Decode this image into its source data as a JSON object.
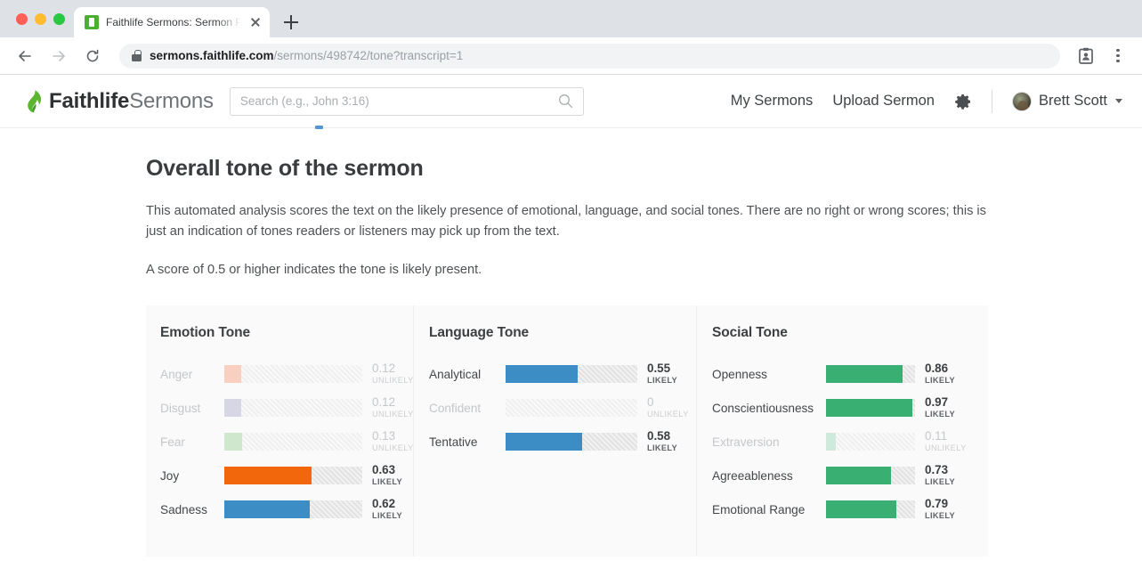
{
  "browser": {
    "tab_title": "Faithlife Sermons: Sermon Prepa",
    "favicon_name": "faithlife-favicon",
    "new_tab_label": "+",
    "url_domain": "sermons.faithlife.com",
    "url_path": "/sermons/498742/tone?transcript=1",
    "back_icon": "back-arrow-icon",
    "forward_icon": "forward-arrow-icon",
    "reload_icon": "reload-icon",
    "lock_icon": "lock-icon",
    "profile_icon": "profile-card-icon",
    "menu_icon": "kebab-menu-icon"
  },
  "header": {
    "brand_bold": "Faithlife",
    "brand_light": "Sermons",
    "brand_icon": "faithlife-flame-logo",
    "search": {
      "placeholder": "Search (e.g., John 3:16)",
      "value": "",
      "icon": "search-icon"
    },
    "nav": [
      {
        "label": "My Sermons",
        "name": "my-sermons"
      },
      {
        "label": "Upload Sermon",
        "name": "upload-sermon"
      }
    ],
    "settings_icon": "gear-icon",
    "user": {
      "name": "Brett Scott",
      "avatar": "user-avatar",
      "caret": "chevron-down-icon"
    }
  },
  "main": {
    "title": "Overall tone of the sermon",
    "paragraph_1": "This automated analysis scores the text on the likely presence of emotional, language, and social tones. There are no right or wrong scores; this is just an indication of tones readers or listeners may pick up from the text.",
    "paragraph_2": "A score of 0.5 or higher indicates the tone is likely present."
  },
  "chart_data": {
    "type": "bar",
    "title": "Overall tone of the sermon",
    "xlabel": "",
    "ylabel": "",
    "xlim": [
      0,
      1
    ],
    "grid": false,
    "legend": "none",
    "orientation": "horizontal",
    "value_threshold": 0.5,
    "panels": [
      {
        "title": "Emotion Tone",
        "name": "emotion-tone",
        "categories": [
          "Anger",
          "Disgust",
          "Fear",
          "Joy",
          "Sadness"
        ],
        "values": [
          0.12,
          0.12,
          0.13,
          0.63,
          0.62
        ],
        "status": [
          "UNLIKELY",
          "UNLIKELY",
          "UNLIKELY",
          "LIKELY",
          "LIKELY"
        ],
        "colors": [
          "#f9cfc2",
          "#d6d6e4",
          "#cfe8cd",
          "#f2660c",
          "#3c8dc5"
        ]
      },
      {
        "title": "Language Tone",
        "name": "language-tone",
        "categories": [
          "Analytical",
          "Confident",
          "Tentative"
        ],
        "values": [
          0.55,
          0,
          0.58
        ],
        "display_values": [
          "0.55",
          "0",
          "0.58"
        ],
        "status": [
          "LIKELY",
          "UNLIKELY",
          "LIKELY"
        ],
        "colors": [
          "#3c8dc5",
          "#efefef",
          "#3c8dc5"
        ]
      },
      {
        "title": "Social Tone",
        "name": "social-tone",
        "categories": [
          "Openness",
          "Conscientiousness",
          "Extraversion",
          "Agreeableness",
          "Emotional Range"
        ],
        "values": [
          0.86,
          0.97,
          0.11,
          0.73,
          0.79
        ],
        "status": [
          "LIKELY",
          "LIKELY",
          "UNLIKELY",
          "LIKELY",
          "LIKELY"
        ],
        "colors": [
          "#3aaf72",
          "#3aaf72",
          "#cfe9dc",
          "#3aaf72",
          "#3aaf72"
        ]
      }
    ]
  }
}
